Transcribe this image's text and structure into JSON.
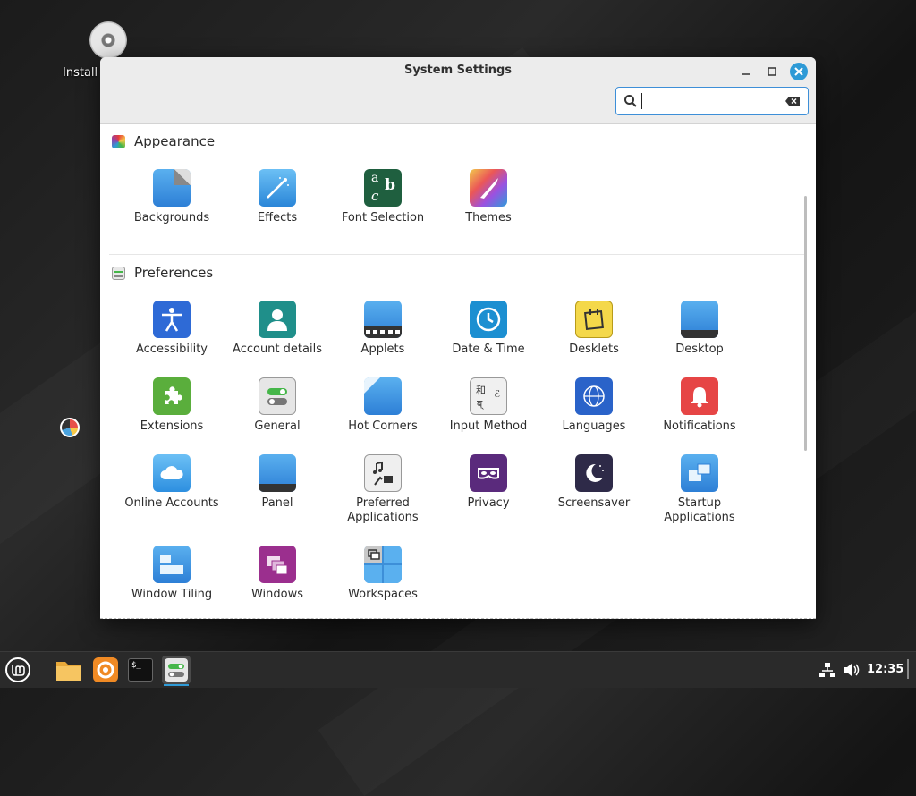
{
  "desktop": {
    "install_label": "Install"
  },
  "window": {
    "title": "System Settings",
    "search_value": ""
  },
  "sections": [
    {
      "title": "Appearance",
      "items": [
        {
          "label": "Backgrounds"
        },
        {
          "label": "Effects"
        },
        {
          "label": "Font Selection"
        },
        {
          "label": "Themes"
        }
      ]
    },
    {
      "title": "Preferences",
      "items": [
        {
          "label": "Accessibility"
        },
        {
          "label": "Account details"
        },
        {
          "label": "Applets"
        },
        {
          "label": "Date & Time"
        },
        {
          "label": "Desklets"
        },
        {
          "label": "Desktop"
        },
        {
          "label": "Extensions"
        },
        {
          "label": "General"
        },
        {
          "label": "Hot Corners"
        },
        {
          "label": "Input Method"
        },
        {
          "label": "Languages"
        },
        {
          "label": "Notifications"
        },
        {
          "label": "Online Accounts"
        },
        {
          "label": "Panel"
        },
        {
          "label": "Preferred Applications"
        },
        {
          "label": "Privacy"
        },
        {
          "label": "Screensaver"
        },
        {
          "label": "Startup Applications"
        },
        {
          "label": "Window Tiling"
        },
        {
          "label": "Windows"
        },
        {
          "label": "Workspaces"
        }
      ]
    }
  ],
  "taskbar": {
    "clock": "12:35"
  },
  "colors": {
    "accent": "#2e9ad6"
  }
}
